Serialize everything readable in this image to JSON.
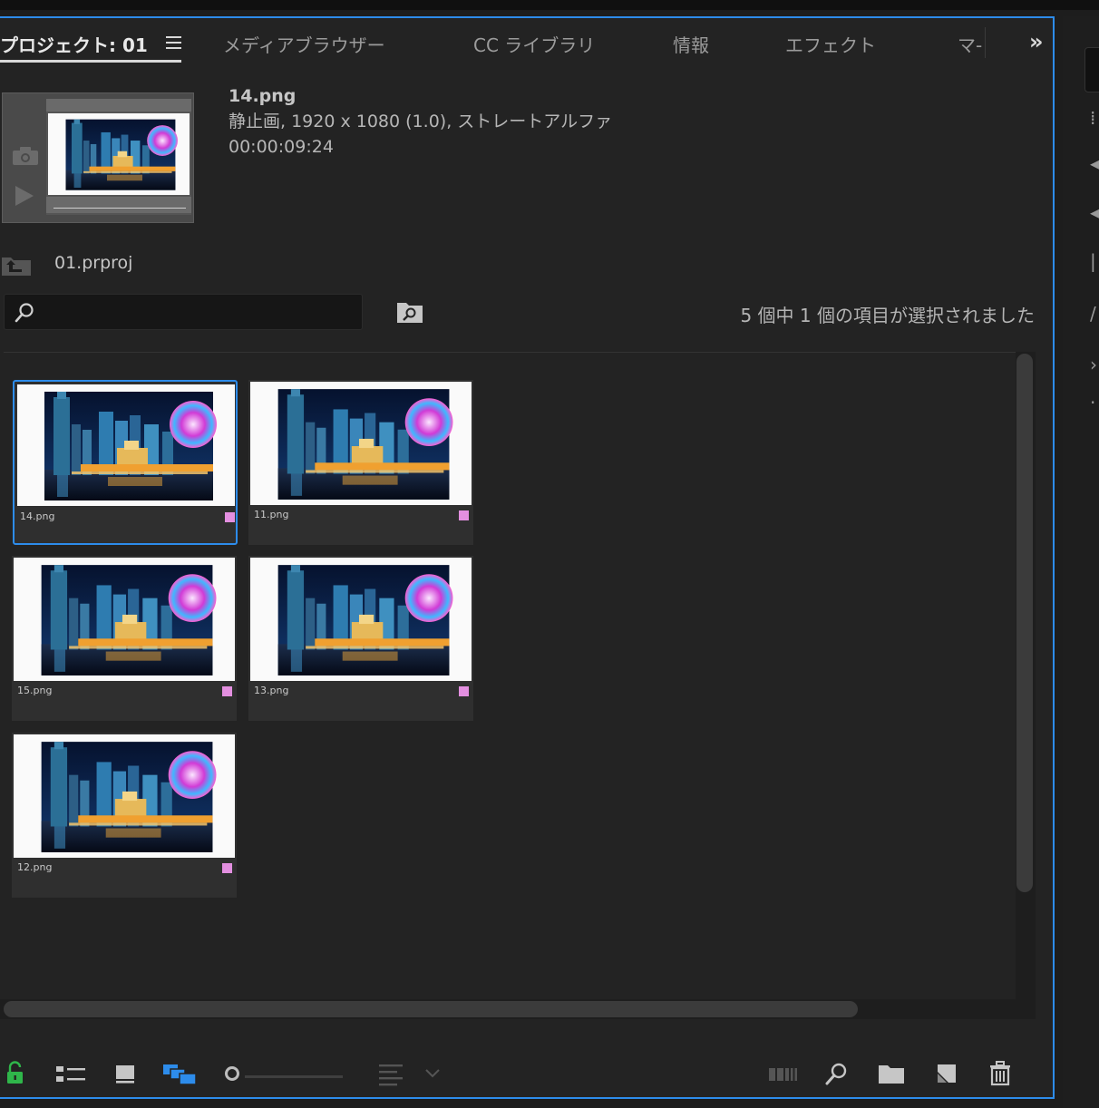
{
  "tabs": {
    "items": [
      {
        "label": "プロジェクト: 01"
      },
      {
        "label": "メディアブラウザー"
      },
      {
        "label": "CC ライブラリ"
      },
      {
        "label": "情報"
      },
      {
        "label": "エフェクト"
      },
      {
        "label": "マ-"
      }
    ],
    "overflow": "»"
  },
  "preview": {
    "filename": "14.png",
    "details": "静止画, 1920 x 1080 (1.0), ストレートアルファ",
    "duration": "00:00:09:24"
  },
  "project": {
    "name": "01.prproj"
  },
  "search": {
    "value": "",
    "placeholder": ""
  },
  "status": {
    "text": "5 個中 1 個の項目が選択されました"
  },
  "items": [
    {
      "name": "14.png",
      "label_color": "#e38fe0",
      "selected": true
    },
    {
      "name": "11.png",
      "label_color": "#e38fe0",
      "selected": false
    },
    {
      "name": "15.png",
      "label_color": "#e38fe0",
      "selected": false
    },
    {
      "name": "13.png",
      "label_color": "#e38fe0",
      "selected": false
    },
    {
      "name": "12.png",
      "label_color": "#e38fe0",
      "selected": false
    }
  ],
  "colors": {
    "accent": "#2d8ceb",
    "label": "#e38fe0",
    "lock": "#2fb64a"
  },
  "toolbar": {
    "zoom_fraction": 0.0,
    "icons": [
      "lock-open-icon",
      "list-view-icon",
      "icon-view-icon",
      "freeform-view-icon",
      "zoom-slider",
      "sort-icon",
      "automate-to-sequence-icon",
      "find-icon",
      "new-bin-icon",
      "new-item-icon",
      "trash-icon"
    ]
  }
}
